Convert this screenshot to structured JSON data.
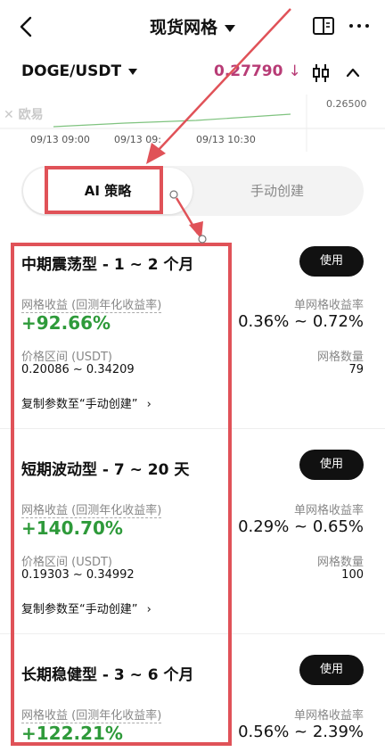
{
  "header": {
    "title": "现货网格",
    "back_icon": "chevron-left-icon",
    "book_icon": "book-icon",
    "more_icon": "more-icon"
  },
  "pair": {
    "symbol": "DOGE/USDT",
    "price": "0.27790",
    "price_arrow": "↓",
    "price_color": "#b83c76"
  },
  "chart": {
    "watermark": "欧易",
    "price_label": "0.26500",
    "ticks": [
      "09/13 09:00",
      "09/13 09:",
      "09/13 10:30"
    ]
  },
  "tabs": {
    "ai": "AI 策略",
    "manual": "手动创建"
  },
  "strategies": [
    {
      "name": "中期震荡型 - 1 ~ 2 个月",
      "use": "使用",
      "yield_label": "网格收益 (回测年化收益率)",
      "yield": "+92.66%",
      "per_grid_label": "单网格收益率",
      "per_grid": "0.36% ~ 0.72%",
      "price_range_label": "价格区间 (USDT)",
      "price_range": "0.20086 ~ 0.34209",
      "grid_count_label": "网格数量",
      "grid_count": "79",
      "copy": "复制参数至“手动创建”"
    },
    {
      "name": "短期波动型 - 7 ~ 20 天",
      "use": "使用",
      "yield_label": "网格收益 (回测年化收益率)",
      "yield": "+140.70%",
      "per_grid_label": "单网格收益率",
      "per_grid": "0.29% ~ 0.65%",
      "price_range_label": "价格区间 (USDT)",
      "price_range": "0.19303 ~ 0.34992",
      "grid_count_label": "网格数量",
      "grid_count": "100",
      "copy": "复制参数至“手动创建”"
    },
    {
      "name": "长期稳健型 - 3 ~ 6 个月",
      "use": "使用",
      "yield_label": "网格收益 (回测年化收益率)",
      "yield": "+122.21%",
      "per_grid_label": "单网格收益率",
      "per_grid": "0.56% ~ 2.39%"
    }
  ],
  "colors": {
    "accent_red": "#e05258",
    "positive_green": "#2e9a3a"
  }
}
